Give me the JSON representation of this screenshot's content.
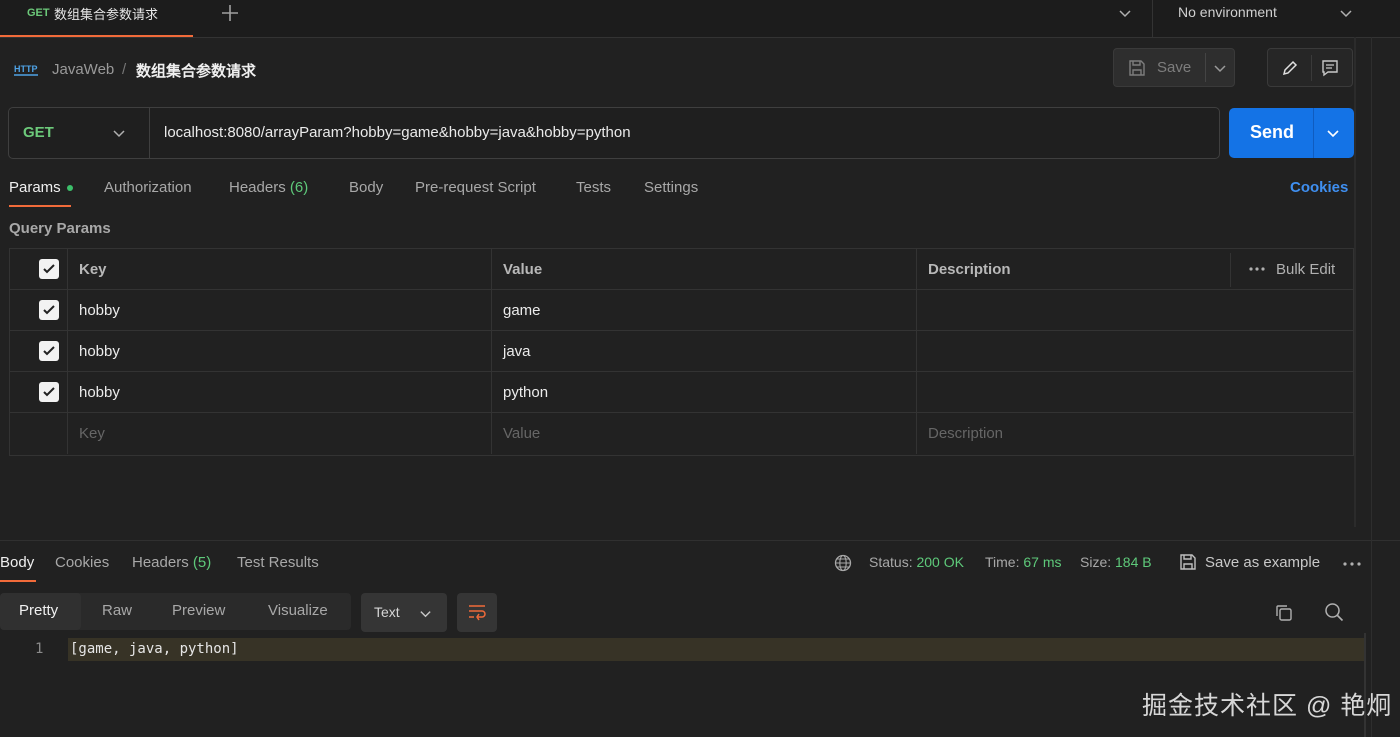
{
  "tab": {
    "method": "GET",
    "title": "数组集合参数请求"
  },
  "environment": {
    "label": "No environment"
  },
  "breadcrumb": {
    "collection": "JavaWeb",
    "separator": "/",
    "request": "数组集合参数请求"
  },
  "toolbar": {
    "save_label": "Save"
  },
  "request": {
    "method": "GET",
    "url": "localhost:8080/arrayParam?hobby=game&hobby=java&hobby=python",
    "send_label": "Send"
  },
  "request_tabs": {
    "params": "Params",
    "authorization": "Authorization",
    "headers": "Headers",
    "headers_count": "(6)",
    "body": "Body",
    "pre_request": "Pre-request Script",
    "tests": "Tests",
    "settings": "Settings",
    "cookies": "Cookies"
  },
  "query_params": {
    "title": "Query Params",
    "columns": {
      "key": "Key",
      "value": "Value",
      "description": "Description",
      "bulk_edit": "Bulk Edit"
    },
    "rows": [
      {
        "key": "hobby",
        "value": "game",
        "description": "",
        "checked": true
      },
      {
        "key": "hobby",
        "value": "java",
        "description": "",
        "checked": true
      },
      {
        "key": "hobby",
        "value": "python",
        "description": "",
        "checked": true
      }
    ],
    "placeholders": {
      "key": "Key",
      "value": "Value",
      "description": "Description"
    }
  },
  "response": {
    "tabs": {
      "body": "Body",
      "cookies": "Cookies",
      "headers": "Headers",
      "headers_count": "(5)",
      "test_results": "Test Results"
    },
    "status_label": "Status:",
    "status_value": "200 OK",
    "time_label": "Time:",
    "time_value": "67 ms",
    "size_label": "Size:",
    "size_value": "184 B",
    "save_example": "Save as example",
    "views": {
      "pretty": "Pretty",
      "raw": "Raw",
      "preview": "Preview",
      "visualize": "Visualize"
    },
    "format": "Text",
    "line_number": "1",
    "content": "[game, java, python]"
  },
  "watermark": "掘金技术社区 @ 艳炯",
  "colors": {
    "accent": "#f26b3a",
    "get": "#6cc97a",
    "send": "#1473e6",
    "link": "#3f8ff0",
    "ok": "#5ec97a"
  },
  "icons": [
    "plus-icon",
    "chevron-down-icon",
    "http-icon",
    "save-icon",
    "edit-icon",
    "comment-icon",
    "check-icon",
    "more-icon",
    "globe-icon",
    "wrap-icon",
    "copy-icon",
    "search-icon"
  ]
}
